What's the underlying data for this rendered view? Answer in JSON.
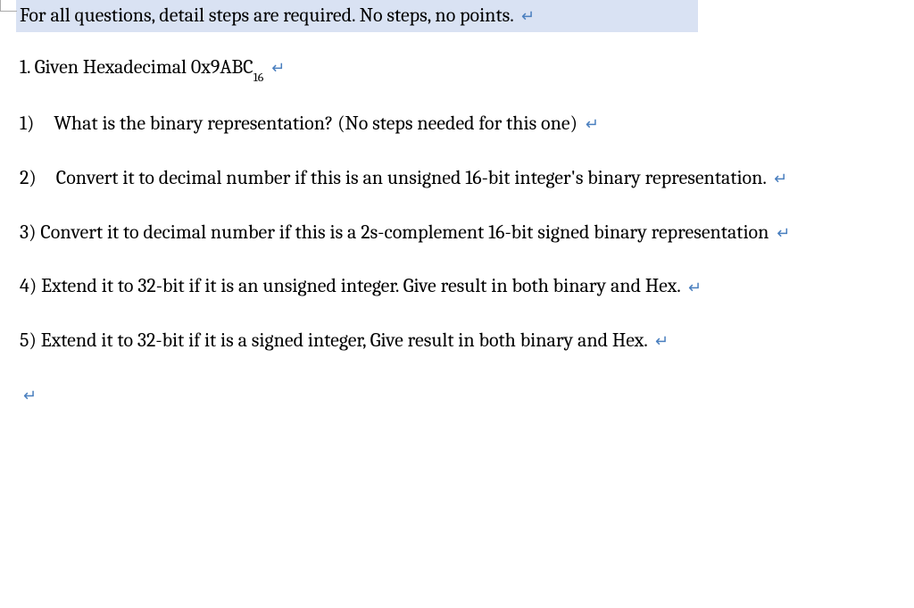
{
  "doc": {
    "instruction": "For all questions, detail steps are required. No steps, no points.",
    "q1_header_prefix": "1. Given Hexadecimal 0x9ABC",
    "q1_header_sub": "16",
    "q1_1": "1) What is the binary representation? (No steps needed for this one)",
    "q1_2": "2) Convert it to decimal number if this is an unsigned 16-bit integer's binary representation.",
    "q1_3": "3) Convert it to decimal number if this is a 2s-complement 16-bit signed binary representation",
    "q1_4": "4) Extend it to 32-bit if it is an unsigned integer. Give result in both binary and Hex.",
    "q1_5": "5) Extend it to 32-bit if it is a signed integer, Give result in both binary and Hex.",
    "para_mark": "↵"
  }
}
